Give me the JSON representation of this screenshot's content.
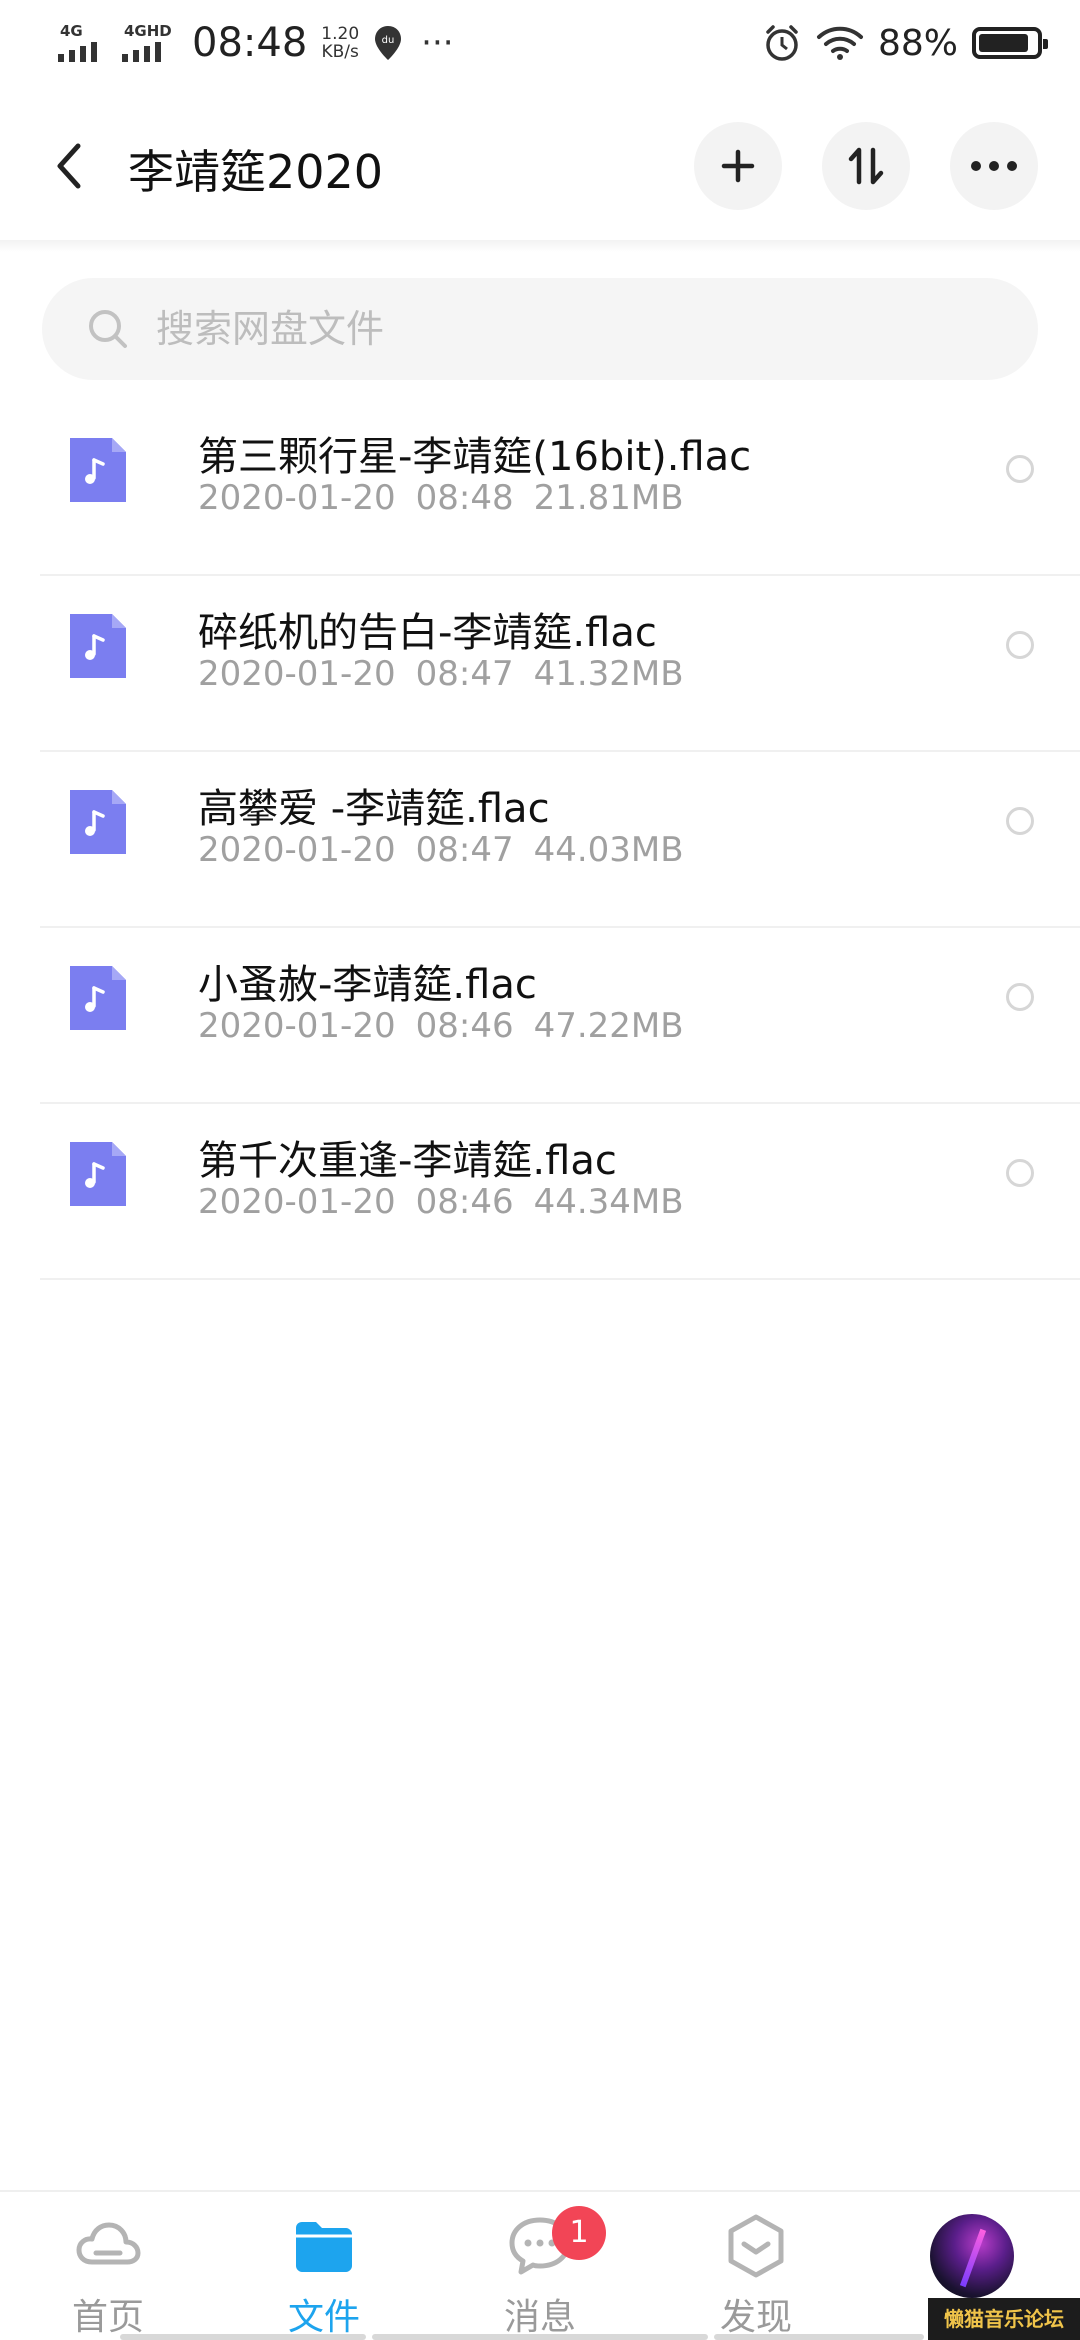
{
  "status_bar": {
    "signal1_label": "4G",
    "signal2_label": "4GHD",
    "time": "08:48",
    "speed_value": "1.20",
    "speed_unit": "KB/s",
    "location_badge": "du",
    "more": "···",
    "battery_percent": "88%",
    "battery_level": 0.88
  },
  "header": {
    "title": "李靖筵2020"
  },
  "search": {
    "placeholder": "搜索网盘文件"
  },
  "files": [
    {
      "name": "第三颗行星-李靖筵(16bit).flac",
      "date": "2020-01-20",
      "time": "08:48",
      "size": "21.81MB"
    },
    {
      "name": "碎纸机的告白-李靖筵.flac",
      "date": "2020-01-20",
      "time": "08:47",
      "size": "41.32MB"
    },
    {
      "name": "高攀爱 -李靖筵.flac",
      "date": "2020-01-20",
      "time": "08:47",
      "size": "44.03MB"
    },
    {
      "name": "小蚤赦-李靖筵.flac",
      "date": "2020-01-20",
      "time": "08:46",
      "size": "47.22MB"
    },
    {
      "name": "第千次重逢-李靖筵.flac",
      "date": "2020-01-20",
      "time": "08:46",
      "size": "44.34MB"
    }
  ],
  "tabs": {
    "home": "首页",
    "files": "文件",
    "messages": "消息",
    "messages_badge": "1",
    "discover": "发现"
  },
  "watermark": "懒猫音乐论坛",
  "colors": {
    "accent": "#1da4ee",
    "file_icon": "#7b7ef0",
    "badge": "#f24556"
  }
}
